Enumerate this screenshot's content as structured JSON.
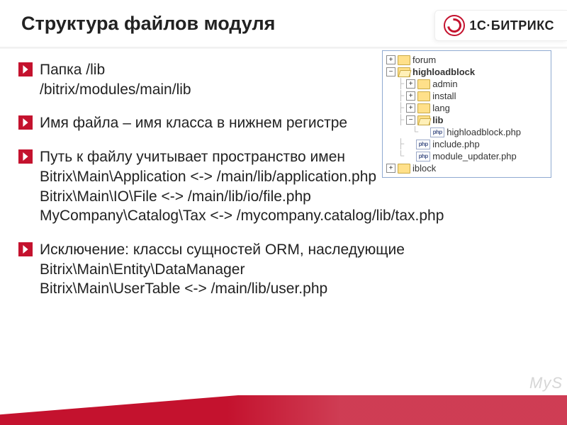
{
  "title": "Структура файлов модуля",
  "brand": "1С·БИТРИКС",
  "watermark": "MyS",
  "bullets": [
    {
      "line1": "Папка   /lib",
      "line2": "/bitrix/modules/main/lib"
    },
    {
      "line1": "Имя файла – имя класса в нижнем регистре"
    },
    {
      "line1": "Путь к файлу учитывает пространство имен",
      "line2": "Bitrix\\Main\\Application  <->  /main/lib/application.php",
      "line3": "Bitrix\\Main\\IO\\File  <->  /main/lib/io/file.php",
      "line4": "MyCompany\\Catalog\\Tax  <->  /mycompany.catalog/lib/tax.php"
    },
    {
      "line1": "Исключение: классы сущностей ORM, наследующие",
      "line2": "Bitrix\\Main\\Entity\\DataManager",
      "line3": "Bitrix\\Main\\UserTable  <->  /main/lib/user.php"
    }
  ],
  "tree": [
    {
      "label": "forum",
      "type": "folder",
      "state": "collapsed"
    },
    {
      "label": "highloadblock",
      "type": "folder",
      "state": "expanded",
      "children": [
        {
          "label": "admin",
          "type": "folder",
          "state": "collapsed"
        },
        {
          "label": "install",
          "type": "folder",
          "state": "collapsed"
        },
        {
          "label": "lang",
          "type": "folder",
          "state": "collapsed"
        },
        {
          "label": "lib",
          "type": "folder",
          "state": "expanded",
          "children": [
            {
              "label": "highloadblock.php",
              "type": "php"
            }
          ]
        },
        {
          "label": "include.php",
          "type": "php"
        },
        {
          "label": "module_updater.php",
          "type": "php"
        }
      ]
    },
    {
      "label": "iblock",
      "type": "folder",
      "state": "collapsed"
    }
  ]
}
